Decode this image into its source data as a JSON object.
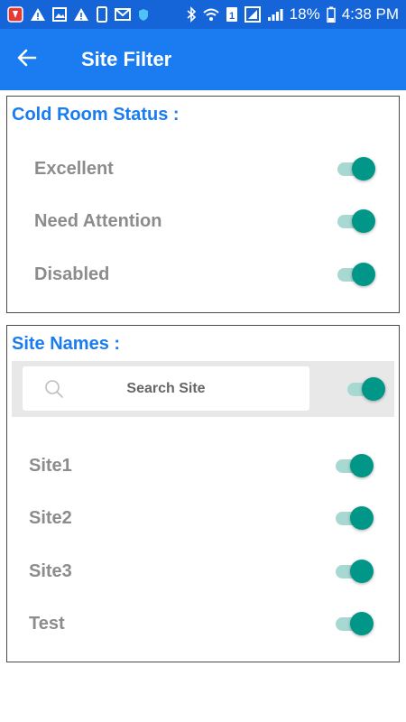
{
  "status_bar": {
    "battery_percent": "18%",
    "time": "4:38 PM",
    "left_icons": [
      "app-notification-icon",
      "warning-icon",
      "image-icon",
      "warning-icon",
      "device-icon",
      "mail-icon",
      "shield-icon"
    ],
    "right_icons": [
      "bluetooth-icon",
      "wifi-icon",
      "sim-icon",
      "signal-box-icon",
      "signal-icon",
      "battery-icon"
    ]
  },
  "app_bar": {
    "title": "Site Filter",
    "back_icon": "arrow-left-icon"
  },
  "colors": {
    "status_bar": "#1565d8",
    "app_bar": "#1a7cf0",
    "section_title": "#1a7cf0",
    "toggle_on": "#009688",
    "toggle_track": "#a7d8d2",
    "label": "#8c8c8c"
  },
  "cold_room": {
    "title": "Cold Room Status :",
    "items": [
      {
        "label": "Excellent",
        "on": true
      },
      {
        "label": "Need Attention",
        "on": true
      },
      {
        "label": "Disabled",
        "on": true
      }
    ]
  },
  "site_names": {
    "title": "Site Names :",
    "search": {
      "placeholder": "Search Site",
      "select_all_on": true
    },
    "items": [
      {
        "label": "Site1",
        "on": true
      },
      {
        "label": "Site2",
        "on": true
      },
      {
        "label": "Site3",
        "on": true
      },
      {
        "label": "Test",
        "on": true
      }
    ]
  }
}
